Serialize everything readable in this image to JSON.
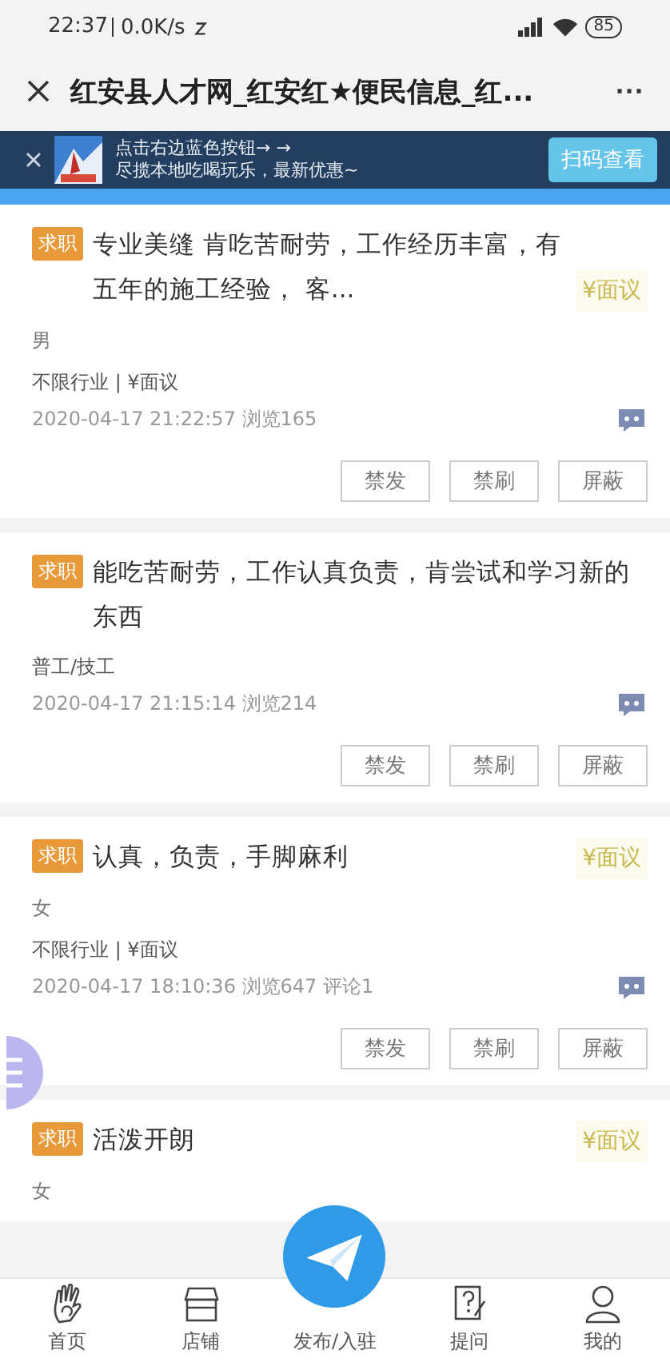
{
  "status_bar": {
    "time": "22:37",
    "speed": "0.0K/s",
    "battery": "85"
  },
  "header": {
    "title": "红安县人才网_红安红★便民信息_红...",
    "more": "···"
  },
  "ad_banner": {
    "lines": [
      "点击右边蓝色按钮→ →",
      "尽揽本地吃喝玩乐，最新优惠~"
    ],
    "button": "扫码查看"
  },
  "posts": [
    {
      "tag": "求职",
      "title": "专业美缝 肯吃苦耐劳，工作经历丰富，有五年的施工经验， 客...",
      "salary": "¥面议",
      "gender": "男",
      "industry": "不限行业 | ¥面议",
      "meta": "2020-04-17 21:22:57  浏览165",
      "buttons": [
        "禁发",
        "禁刷",
        "屏蔽"
      ]
    },
    {
      "tag": "求职",
      "title": "能吃苦耐劳，工作认真负责，肯尝试和学习新的东西",
      "industry": "普工/技工",
      "meta": "2020-04-17 21:15:14  浏览214",
      "buttons": [
        "禁发",
        "禁刷",
        "屏蔽"
      ]
    },
    {
      "tag": "求职",
      "title": "认真，负责，手脚麻利",
      "salary": "¥面议",
      "gender": "女",
      "industry": "不限行业 | ¥面议",
      "meta": "2020-04-17 18:10:36  浏览647 评论1",
      "buttons": [
        "禁发",
        "禁刷",
        "屏蔽"
      ]
    },
    {
      "tag": "求职",
      "title": "活泼开朗",
      "salary": "¥面议",
      "gender": "女"
    }
  ],
  "nav": [
    {
      "kind": "hand",
      "label": "首页"
    },
    {
      "kind": "shop",
      "label": "店铺"
    },
    {
      "kind": "publish",
      "label": "发布/入驻"
    },
    {
      "kind": "ask",
      "label": "提问"
    },
    {
      "kind": "person",
      "label": "我的"
    }
  ]
}
